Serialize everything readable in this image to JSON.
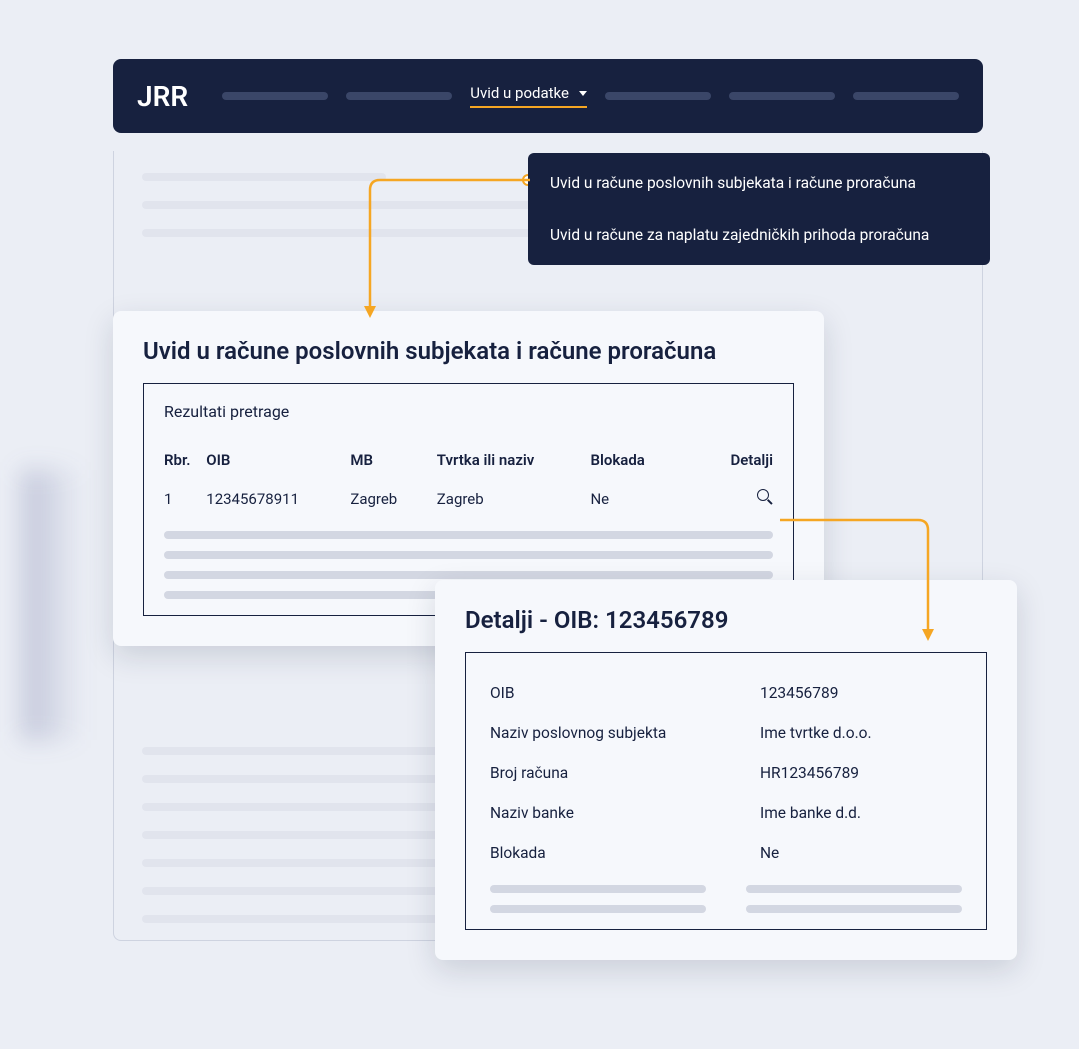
{
  "navbar": {
    "logo": "JRR",
    "active_item": "Uvid u podatke"
  },
  "dropdown": {
    "items": [
      "Uvid u račune poslovnih subjekata i račune proračuna",
      "Uvid u račune za naplatu zajedničkih prihoda proračuna"
    ]
  },
  "results": {
    "title": "Uvid u račune poslovnih subjekata i račune proračuna",
    "subtitle": "Rezultati pretrage",
    "headers": {
      "rbr": "Rbr.",
      "oib": "OIB",
      "mb": "MB",
      "tvrtka": "Tvrtka ili naziv",
      "blokada": "Blokada",
      "detalji": "Detalji"
    },
    "row": {
      "rbr": "1",
      "oib": "12345678911",
      "mb": "Zagreb",
      "tvrtka": "Zagreb",
      "blokada": "Ne"
    }
  },
  "details": {
    "title": "Detalji - OIB: 123456789",
    "rows": [
      {
        "label": "OIB",
        "value": "123456789"
      },
      {
        "label": "Naziv poslovnog subjekta",
        "value": "Ime tvrtke d.o.o."
      },
      {
        "label": "Broj računa",
        "value": "HR123456789"
      },
      {
        "label": "Naziv banke",
        "value": "Ime banke d.d."
      },
      {
        "label": "Blokada",
        "value": "Ne"
      }
    ]
  },
  "colors": {
    "primary_dark": "#17213F",
    "accent": "#F5A623",
    "background": "#EBEEF5",
    "card_bg": "#F6F8FC"
  }
}
